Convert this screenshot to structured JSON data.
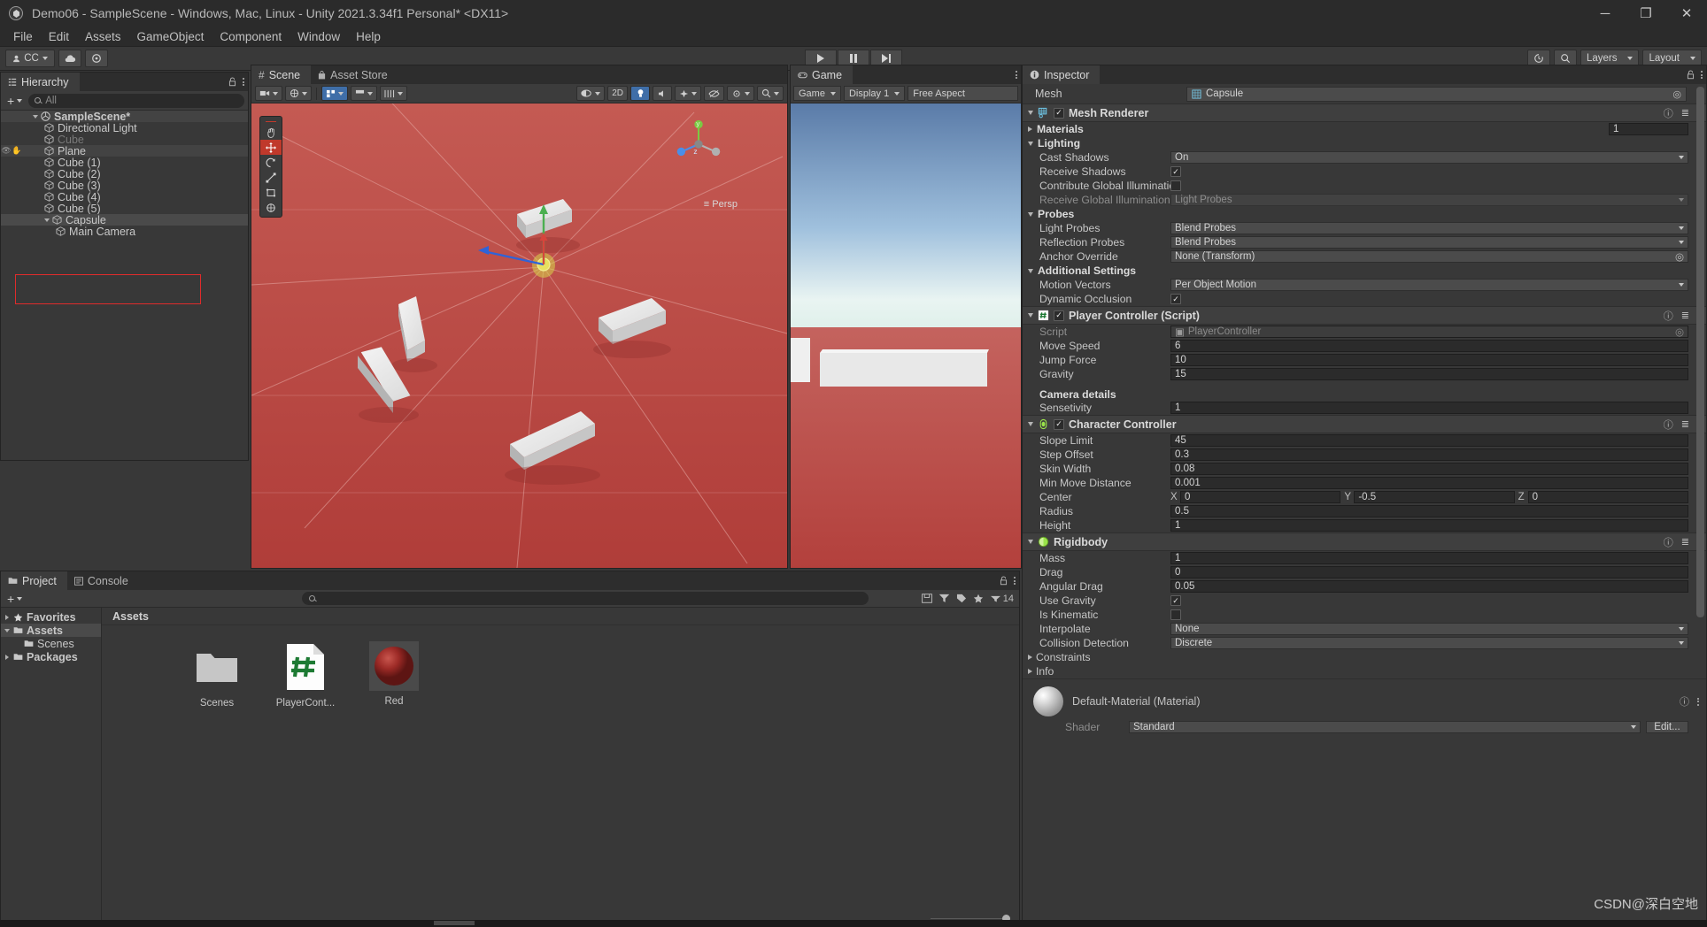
{
  "window": {
    "title": "Demo06 - SampleScene - Windows, Mac, Linux - Unity 2021.3.34f1 Personal* <DX11>",
    "minimize": "─",
    "maximize": "❐",
    "close": "✕"
  },
  "menu": [
    "File",
    "Edit",
    "Assets",
    "GameObject",
    "Component",
    "Window",
    "Help"
  ],
  "toolbar": {
    "account_label": "CC",
    "cloud_icon": "cloud-icon",
    "settings_icon": "gear-icon",
    "play_icon": "play-icon",
    "pause_icon": "pause-icon",
    "step_icon": "step-icon",
    "history_icon": "history-icon",
    "search_icon": "search-icon",
    "layers_label": "Layers",
    "layout_label": "Layout"
  },
  "hierarchy": {
    "tab_label": "Hierarchy",
    "search_placeholder": "All",
    "plus_label": "+",
    "items": [
      {
        "label": "SampleScene*",
        "depth": 0,
        "icon": "scene-icon",
        "expanded": true,
        "state": "header"
      },
      {
        "label": "Directional Light",
        "depth": 1,
        "icon": "gameobject-icon",
        "state": "normal"
      },
      {
        "label": "Cube",
        "depth": 1,
        "icon": "gameobject-icon",
        "state": "dim"
      },
      {
        "label": "Plane",
        "depth": 1,
        "icon": "gameobject-icon",
        "state": "hover"
      },
      {
        "label": "Cube (1)",
        "depth": 1,
        "icon": "gameobject-icon",
        "state": "normal"
      },
      {
        "label": "Cube (2)",
        "depth": 1,
        "icon": "gameobject-icon",
        "state": "normal"
      },
      {
        "label": "Cube (3)",
        "depth": 1,
        "icon": "gameobject-icon",
        "state": "normal"
      },
      {
        "label": "Cube (4)",
        "depth": 1,
        "icon": "gameobject-icon",
        "state": "normal"
      },
      {
        "label": "Cube (5)",
        "depth": 1,
        "icon": "gameobject-icon",
        "state": "normal"
      },
      {
        "label": "Capsule",
        "depth": 1,
        "icon": "gameobject-icon",
        "expanded": true,
        "state": "selected"
      },
      {
        "label": "Main Camera",
        "depth": 2,
        "icon": "gameobject-icon",
        "state": "normal"
      }
    ]
  },
  "scene": {
    "tabs": [
      {
        "label": "Scene",
        "icon": "scene-icon",
        "active": true
      },
      {
        "label": "Asset Store",
        "icon": "store-icon",
        "active": false
      }
    ],
    "toolbar": {
      "shading_mode": "Shaded",
      "two_d_label": "2D",
      "gizmos_label": "Gizmos",
      "persp_label": "≡ Persp",
      "axis_x": "x",
      "axis_y": "y",
      "axis_z": "z"
    },
    "tools": [
      "hand-tool",
      "move-tool",
      "rotate-tool",
      "scale-tool",
      "rect-tool",
      "transform-tool"
    ]
  },
  "game": {
    "tab_label": "Game",
    "view_label": "Game",
    "display": "Display 1",
    "aspect": "Free Aspect"
  },
  "project": {
    "tabs": [
      {
        "label": "Project",
        "icon": "folder-icon",
        "active": true
      },
      {
        "label": "Console",
        "icon": "console-icon",
        "active": false
      }
    ],
    "search_placeholder": "",
    "badge_count": "14",
    "tree": [
      {
        "label": "Favorites",
        "icon": "star-icon",
        "depth": 0,
        "expandable": true,
        "selected": false
      },
      {
        "label": "Assets",
        "icon": "folder-open-icon",
        "depth": 0,
        "expandable": true,
        "selected": true
      },
      {
        "label": "Scenes",
        "icon": "folder-icon",
        "depth": 1,
        "expandable": false,
        "selected": false
      },
      {
        "label": "Packages",
        "icon": "folder-icon",
        "depth": 0,
        "expandable": true,
        "selected": false
      }
    ],
    "breadcrumb": "Assets",
    "assets": [
      {
        "label": "Scenes",
        "type": "folder"
      },
      {
        "label": "PlayerCont...",
        "type": "csharp-script"
      },
      {
        "label": "Red",
        "type": "material"
      }
    ]
  },
  "inspector": {
    "tab_label": "Inspector",
    "object_label": "Mesh",
    "object_value": "Capsule",
    "components": [
      {
        "name": "Mesh Renderer",
        "icon": "mesh-renderer-icon",
        "enabled": true,
        "expanded": true,
        "groups": [
          {
            "label": "Materials",
            "expanded": false,
            "value": "1"
          },
          {
            "label": "Lighting",
            "expanded": true
          },
          {
            "label": "Probes",
            "expanded": true
          },
          {
            "label": "Additional Settings",
            "expanded": true
          }
        ],
        "rows": [
          {
            "label": "Cast Shadows",
            "value": "On",
            "kind": "popup",
            "group": "Lighting"
          },
          {
            "label": "Receive Shadows",
            "value": true,
            "kind": "checkbox",
            "group": "Lighting"
          },
          {
            "label": "Contribute Global Illumination",
            "value": false,
            "kind": "checkbox",
            "group": "Lighting"
          },
          {
            "label": "Receive Global Illumination",
            "value": "Light Probes",
            "kind": "popup-disabled",
            "group": "Lighting"
          },
          {
            "label": "Light Probes",
            "value": "Blend Probes",
            "kind": "popup",
            "group": "Probes"
          },
          {
            "label": "Reflection Probes",
            "value": "Blend Probes",
            "kind": "popup",
            "group": "Probes"
          },
          {
            "label": "Anchor Override",
            "value": "None (Transform)",
            "kind": "objectfield",
            "group": "Probes"
          },
          {
            "label": "Motion Vectors",
            "value": "Per Object Motion",
            "kind": "popup",
            "group": "Additional Settings"
          },
          {
            "label": "Dynamic Occlusion",
            "value": true,
            "kind": "checkbox",
            "group": "Additional Settings"
          }
        ]
      },
      {
        "name": "Player Controller (Script)",
        "icon": "csharp-script-icon",
        "enabled": true,
        "expanded": true,
        "rows": [
          {
            "label": "Script",
            "value": "PlayerController",
            "kind": "script-readonly"
          },
          {
            "label": "Move Speed",
            "value": "6",
            "kind": "number"
          },
          {
            "label": "Jump Force",
            "value": "10",
            "kind": "number"
          },
          {
            "label": "Gravity",
            "value": "15",
            "kind": "number"
          },
          {
            "label": "Camera details",
            "value": "",
            "kind": "header"
          },
          {
            "label": "Sensetivity",
            "value": "1",
            "kind": "number"
          }
        ]
      },
      {
        "name": "Character Controller",
        "icon": "character-controller-icon",
        "enabled": true,
        "expanded": true,
        "rows": [
          {
            "label": "Slope Limit",
            "value": "45",
            "kind": "number"
          },
          {
            "label": "Step Offset",
            "value": "0.3",
            "kind": "number"
          },
          {
            "label": "Skin Width",
            "value": "0.08",
            "kind": "number"
          },
          {
            "label": "Min Move Distance",
            "value": "0.001",
            "kind": "number"
          },
          {
            "label": "Center",
            "value": {
              "x": "0",
              "y": "-0.5",
              "z": "0"
            },
            "kind": "vector3"
          },
          {
            "label": "Radius",
            "value": "0.5",
            "kind": "number"
          },
          {
            "label": "Height",
            "value": "1",
            "kind": "number"
          }
        ]
      },
      {
        "name": "Rigidbody",
        "icon": "rigidbody-icon",
        "enabled": null,
        "expanded": true,
        "rows": [
          {
            "label": "Mass",
            "value": "1",
            "kind": "number"
          },
          {
            "label": "Drag",
            "value": "0",
            "kind": "number"
          },
          {
            "label": "Angular Drag",
            "value": "0.05",
            "kind": "number"
          },
          {
            "label": "Use Gravity",
            "value": true,
            "kind": "checkbox"
          },
          {
            "label": "Is Kinematic",
            "value": false,
            "kind": "checkbox"
          },
          {
            "label": "Interpolate",
            "value": "None",
            "kind": "popup"
          },
          {
            "label": "Collision Detection",
            "value": "Discrete",
            "kind": "popup"
          },
          {
            "label": "Constraints",
            "value": "",
            "kind": "foldout"
          },
          {
            "label": "Info",
            "value": "",
            "kind": "foldout"
          }
        ]
      }
    ],
    "material": {
      "title": "Default-Material (Material)",
      "shader_label": "Shader",
      "shader_value": "Standard",
      "edit_label": "Edit..."
    },
    "vector_axes": {
      "x": "X",
      "y": "Y",
      "z": "Z"
    }
  },
  "watermark": "CSDN@深白空地"
}
